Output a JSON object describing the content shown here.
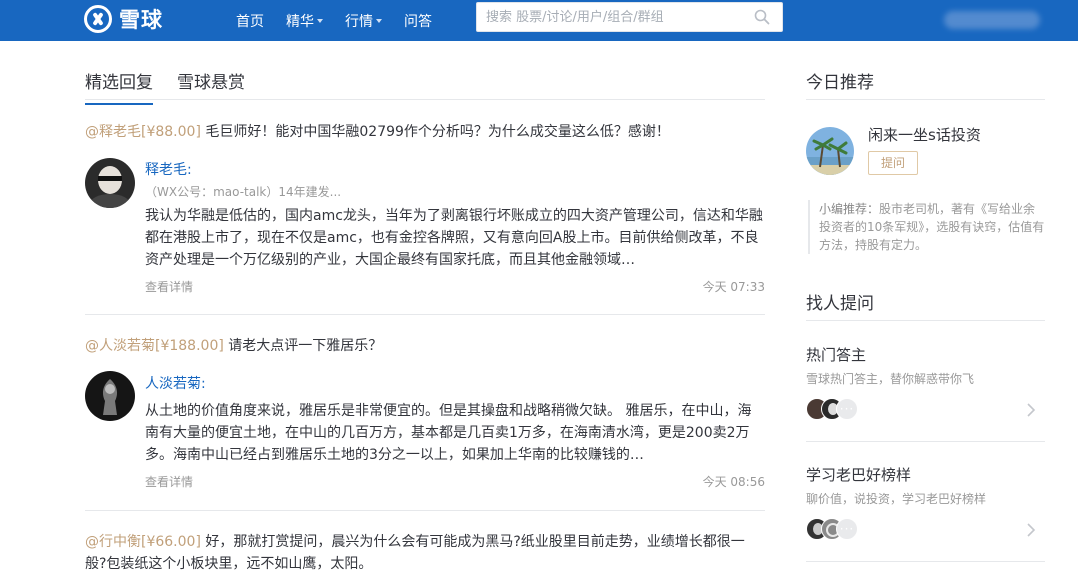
{
  "header": {
    "logo_text": "雪球",
    "nav": [
      {
        "label": "首页",
        "dropdown": false
      },
      {
        "label": "精华",
        "dropdown": true
      },
      {
        "label": "行情",
        "dropdown": true
      },
      {
        "label": "问答",
        "dropdown": false
      }
    ],
    "search_placeholder": "搜索 股票/讨论/用户/组合/群组",
    "brand_color": "#1867c0"
  },
  "tabs": [
    {
      "label": "精选回复",
      "active": true
    },
    {
      "label": "雪球悬赏",
      "active": false
    }
  ],
  "posts": [
    {
      "asker": "@释老毛[¥88.00]",
      "question": "毛巨师好！能对中国华融02799作个分析吗？为什么成交量这么低？感谢！",
      "answerer": "释老毛:",
      "answerer_desc": "（WX公号：mao-talk）14年建发...",
      "answer": "我认为华融是低估的，国内amc龙头，当年为了剥离银行坏账成立的四大资产管理公司，信达和华融都在港股上市了，现在不仅是amc，也有金控各牌照，又有意向回A股上市。目前供给侧改革，不良资产处理是一个万亿级别的产业，大国企最终有国家托底，而且其他金融领域…",
      "more": "查看详情",
      "time": "今天 07:33"
    },
    {
      "asker": "@人淡若菊[¥188.00]",
      "question": "请老大点评一下雅居乐？",
      "answerer": "人淡若菊:",
      "answerer_desc": "",
      "answer": "从土地的价值角度来说，雅居乐是非常便宜的。但是其操盘和战略稍微欠缺。 雅居乐，在中山，海南有大量的便宜土地，在中山的几百万方，基本都是几百卖1万多，在海南清水湾，更是200卖2万多。海南中山已经占到雅居乐土地的3分之一以上，如果加上华南的比较赚钱的…",
      "more": "查看详情",
      "time": "今天 08:56"
    },
    {
      "asker": "@行中衡[¥66.00]",
      "question": "好，那就打赏提问，晨兴为什么会有可能成为黑马?纸业股里目前走势，业绩增长都很一般?包装纸这个小板块里，远不如山鹰，太阳。"
    }
  ],
  "sidebar": {
    "today_title": "今日推荐",
    "rec_name": "闲来一坐s话投资",
    "ask_button": "提问",
    "rec_note_label": "小编推荐：",
    "rec_note": "股市老司机，著有《写给业余投资者的10条军规》，选股有诀窍，估值有方法，持股有定力。",
    "find_title": "找人提问",
    "groups": [
      {
        "title": "热门答主",
        "subtitle": "雪球热门答主，替你解惑带你飞",
        "more_dots": "···"
      },
      {
        "title": "学习老巴好榜样",
        "subtitle": "聊价值，说投资，学习老巴好榜样",
        "more_dots": "···"
      }
    ]
  }
}
